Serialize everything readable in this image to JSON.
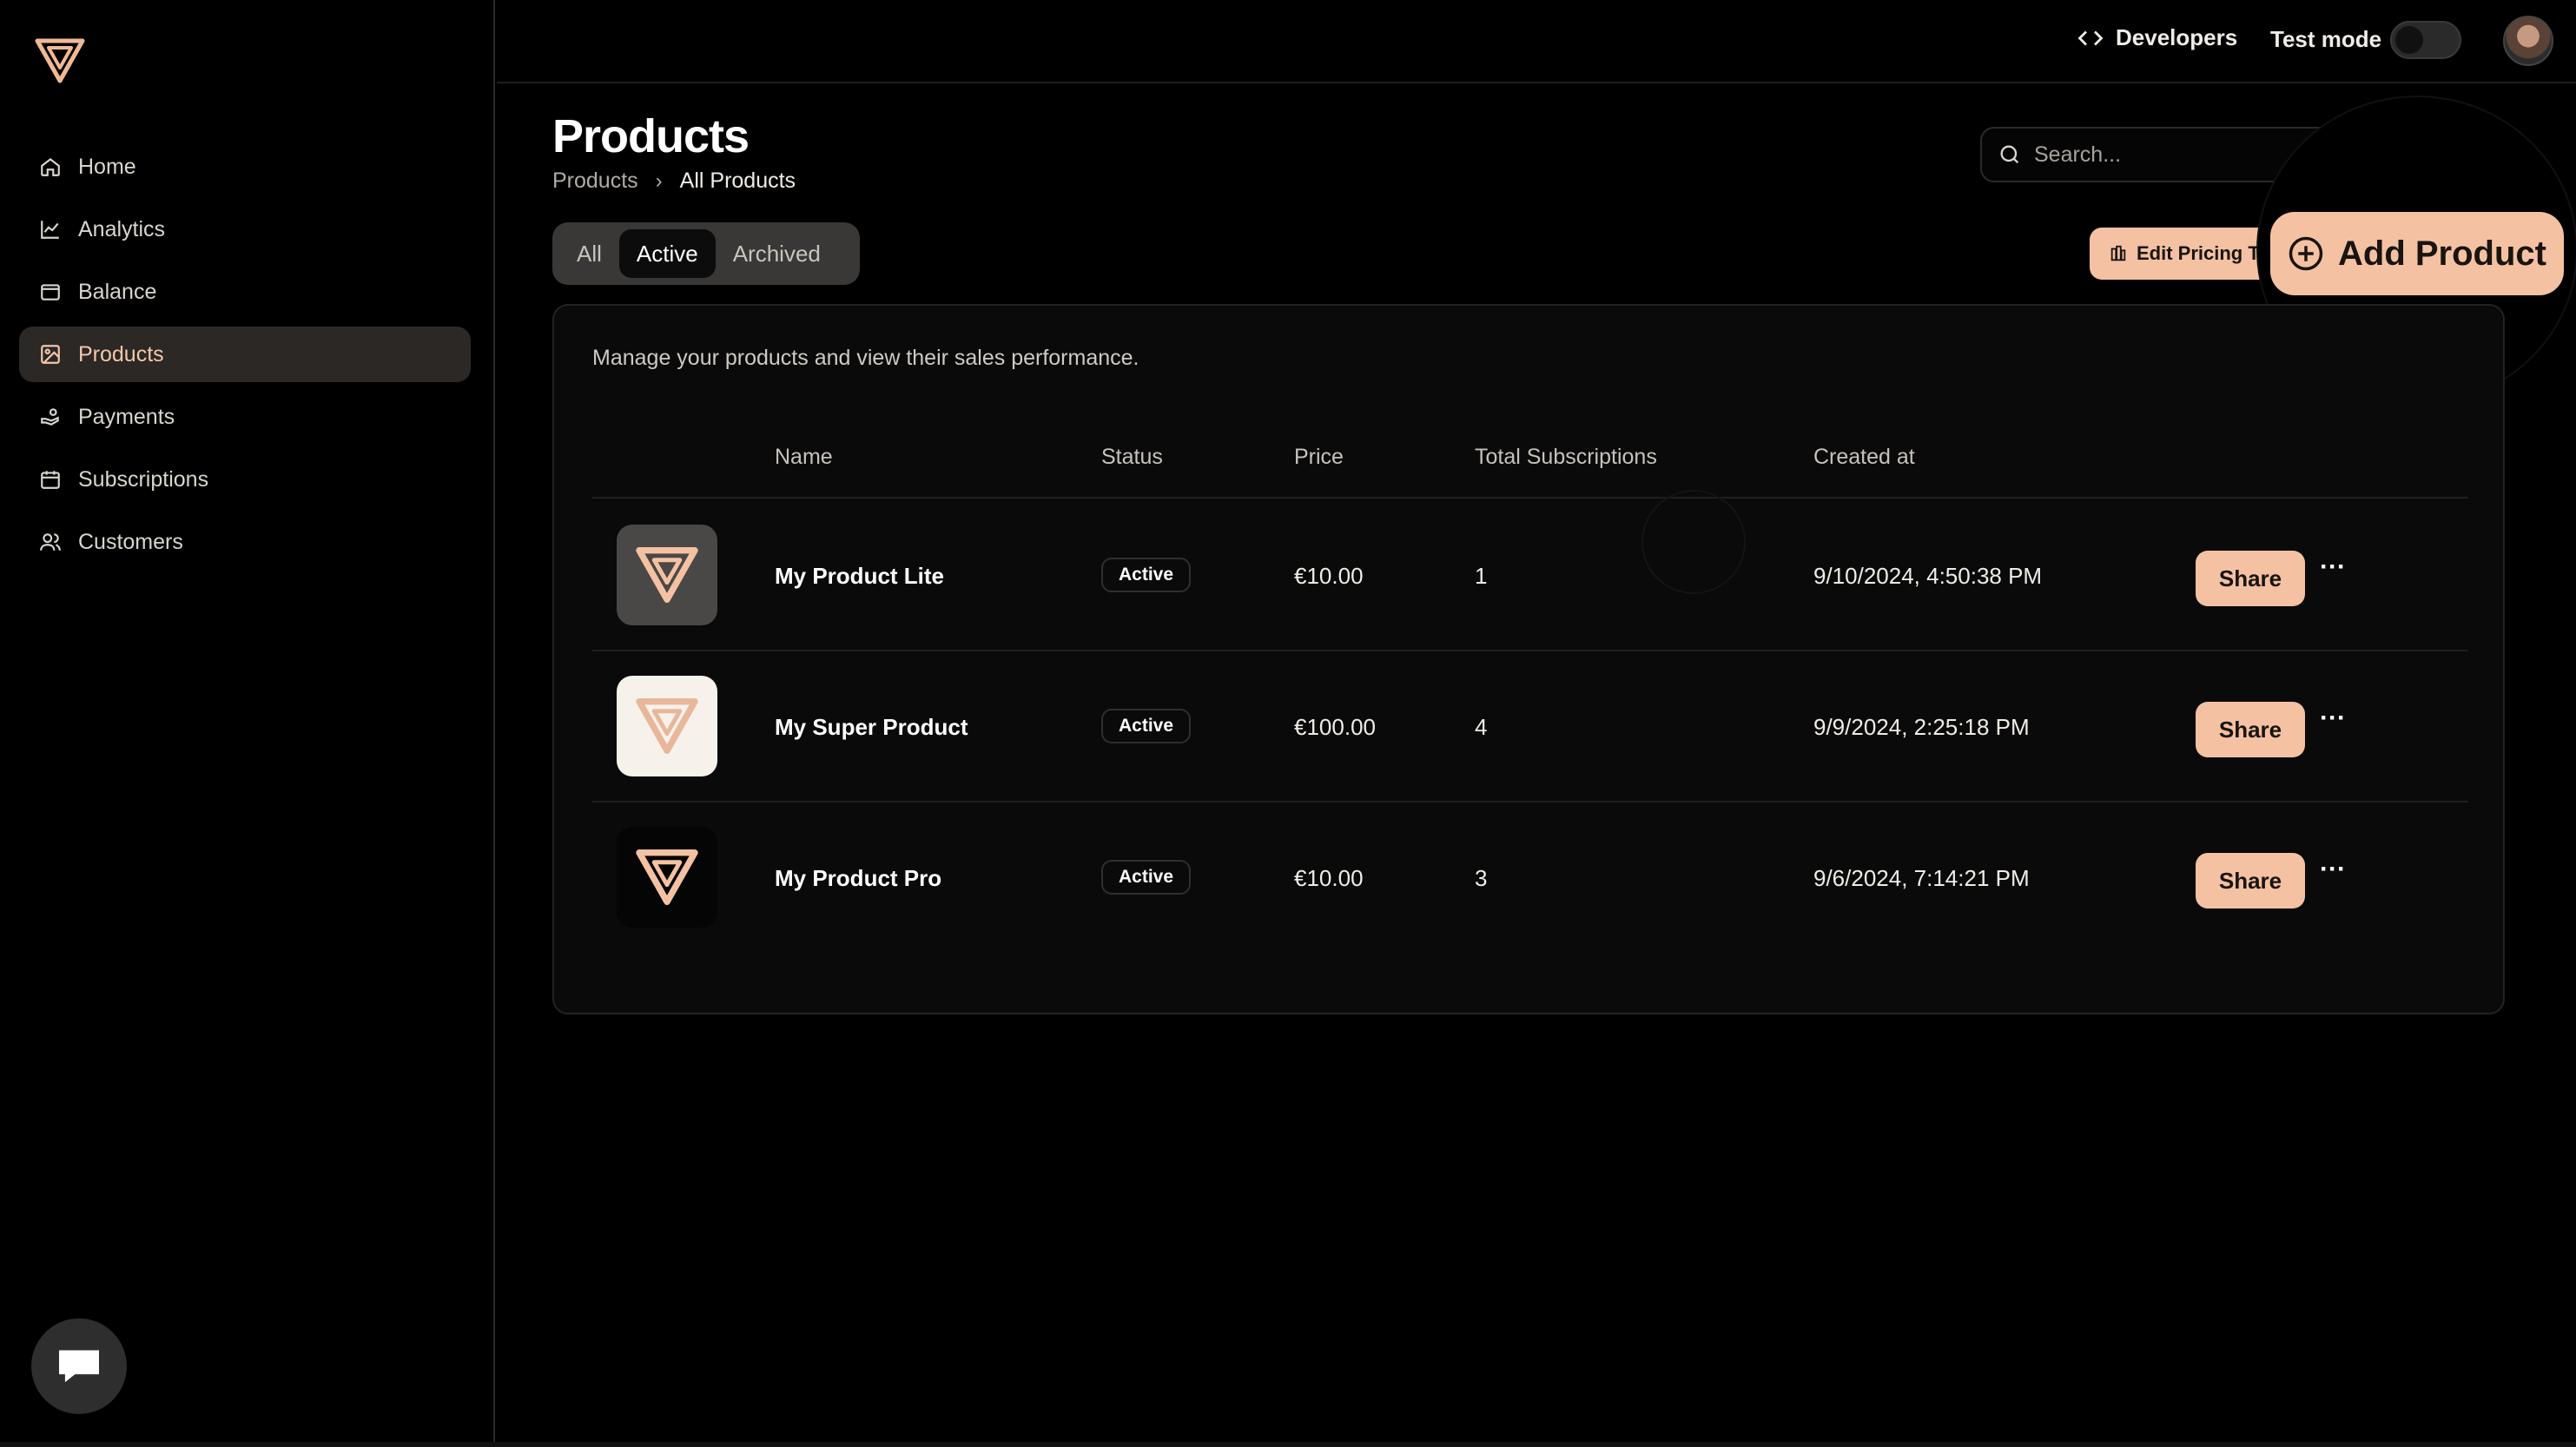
{
  "sidebar": {
    "items": [
      {
        "label": "Home",
        "icon": "home-icon",
        "active": false
      },
      {
        "label": "Analytics",
        "icon": "chart-icon",
        "active": false
      },
      {
        "label": "Balance",
        "icon": "wallet-icon",
        "active": false
      },
      {
        "label": "Products",
        "icon": "image-icon",
        "active": true
      },
      {
        "label": "Payments",
        "icon": "hand-coin-icon",
        "active": false
      },
      {
        "label": "Subscriptions",
        "icon": "calendar-icon",
        "active": false
      },
      {
        "label": "Customers",
        "icon": "users-icon",
        "active": false
      }
    ]
  },
  "topbar": {
    "developers_label": "Developers",
    "test_mode_label": "Test mode"
  },
  "page": {
    "title": "Products",
    "breadcrumb": [
      "Products",
      "All Products"
    ],
    "search_placeholder": "Search..."
  },
  "tabs": [
    {
      "label": "All",
      "active": false
    },
    {
      "label": "Active",
      "active": true
    },
    {
      "label": "Archived",
      "active": false
    }
  ],
  "actions": {
    "edit_pricing_label": "Edit Pricing Ta",
    "add_product_label": "Add Product"
  },
  "card": {
    "description": "Manage your products and view their sales performance.",
    "headers": {
      "name": "Name",
      "status": "Status",
      "price": "Price",
      "subscriptions": "Total Subscriptions",
      "created": "Created at"
    },
    "rows": [
      {
        "name": "My Product Lite",
        "status": "Active",
        "price": "€10.00",
        "subscriptions": "1",
        "created": "9/10/2024, 4:50:38 PM",
        "share": "Share",
        "thumb_style": "gray"
      },
      {
        "name": "My Super Product",
        "status": "Active",
        "price": "€100.00",
        "subscriptions": "4",
        "created": "9/9/2024, 2:25:18 PM",
        "share": "Share",
        "thumb_style": "light"
      },
      {
        "name": "My Product Pro",
        "status": "Active",
        "price": "€10.00",
        "subscriptions": "3",
        "created": "9/6/2024, 7:14:21 PM",
        "share": "Share",
        "thumb_style": "dark"
      }
    ]
  },
  "colors": {
    "accent": "#f4c2a2",
    "background": "#000000",
    "active_nav": "#2b2826"
  }
}
